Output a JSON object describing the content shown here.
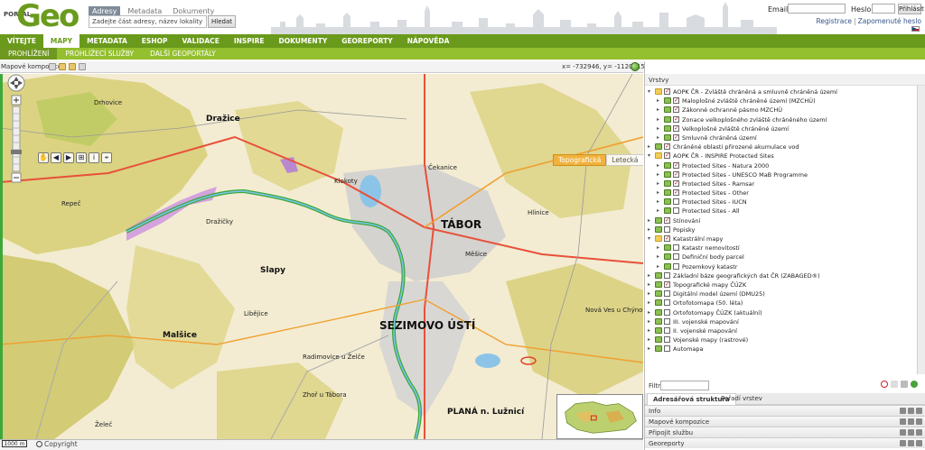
{
  "header": {
    "logo_small": "PORTAL",
    "logo_big": "Geo",
    "search_tabs": [
      "Adresy",
      "Metadata",
      "Dokumenty"
    ],
    "search_placeholder": "Zadejte část adresy, název lokality",
    "search_button": "Hledat",
    "login": {
      "email_label": "Email:",
      "password_label": "Heslo:",
      "login_button": "Přihlásit",
      "register_link": "Registrace",
      "separator": "|",
      "forgot_link": "Zapomenuté heslo"
    }
  },
  "main_nav": [
    "VÍTEJTE",
    "MAPY",
    "METADATA",
    "ESHOP",
    "VALIDACE",
    "INSPIRE",
    "DOKUMENTY",
    "GEOREPORTY",
    "NÁPOVĚDA"
  ],
  "sub_nav": [
    "PROHLÍŽENÍ",
    "PROHLÍŽECÍ SLUŽBY",
    "DALŠÍ GEOPORTÁLY"
  ],
  "map_toolbar": {
    "label": "Mapové kompozice",
    "coords": "x= -732946, y= -1120915"
  },
  "map": {
    "type_buttons": [
      "Topografická",
      "Letecká"
    ],
    "active_type": "Topografická",
    "labels": [
      "Drhovice",
      "Dražice",
      "Repeč",
      "Dražičky",
      "Slapy",
      "Libějice",
      "Malšice",
      "Radimovice u Želče",
      "Zhoř u Tábora",
      "Želeč",
      "TÁBOR",
      "SEZIMOVO ÚSTÍ",
      "PLANÁ n. Lužnicí",
      "Čekanice",
      "Klokoty",
      "Nová Ves u Chýnova",
      "Hlinice",
      "Měšice"
    ],
    "scale": "1000 m",
    "copyright": "Copyright"
  },
  "layers_panel": {
    "title": "Vrstvy",
    "tree": [
      {
        "level": 0,
        "type": "folder",
        "checked": true,
        "expanded": true,
        "label": "AOPK ČR - Zvláště chráněná a smluvně chráněná území"
      },
      {
        "level": 1,
        "type": "layer",
        "checked": true,
        "label": "Maloplošné zvláště chráněné území (MZCHÚ)"
      },
      {
        "level": 1,
        "type": "layer",
        "checked": true,
        "label": "Zákonné ochranné pásmo MZCHÚ"
      },
      {
        "level": 1,
        "type": "layer",
        "checked": true,
        "label": "Zonace velkoplošného zvláště chráněného území"
      },
      {
        "level": 1,
        "type": "layer",
        "checked": true,
        "label": "Velkoplošné zvláště chráněné území"
      },
      {
        "level": 1,
        "type": "layer",
        "checked": true,
        "label": "Smluvně chráněná území"
      },
      {
        "level": 0,
        "type": "layer",
        "checked": true,
        "label": "Chráněné oblasti přirozené akumulace vod"
      },
      {
        "level": 0,
        "type": "folder",
        "checked": true,
        "expanded": true,
        "label": "AOPK ČR - INSPIRE Protected Sites"
      },
      {
        "level": 1,
        "type": "layer",
        "checked": true,
        "label": "Protected Sites - Natura 2000"
      },
      {
        "level": 1,
        "type": "layer",
        "checked": true,
        "label": "Protected Sites - UNESCO MaB Programme"
      },
      {
        "level": 1,
        "type": "layer",
        "checked": true,
        "label": "Protected Sites - Ramsar"
      },
      {
        "level": 1,
        "type": "layer",
        "checked": true,
        "label": "Protected Sites - Other"
      },
      {
        "level": 1,
        "type": "layer",
        "checked": false,
        "label": "Protected Sites - IUCN"
      },
      {
        "level": 1,
        "type": "layer",
        "checked": false,
        "label": "Protected Sites - All"
      },
      {
        "level": 0,
        "type": "layer",
        "checked": true,
        "label": "Stínování"
      },
      {
        "level": 0,
        "type": "layer",
        "checked": false,
        "label": "Popisky"
      },
      {
        "level": 0,
        "type": "folder",
        "checked": true,
        "expanded": true,
        "label": "Katastrální mapy"
      },
      {
        "level": 1,
        "type": "layer",
        "checked": false,
        "label": "Katastr nemovitostí"
      },
      {
        "level": 1,
        "type": "layer",
        "checked": false,
        "label": "Definiční body parcel"
      },
      {
        "level": 1,
        "type": "layer",
        "checked": false,
        "label": "Pozemkový katastr"
      },
      {
        "level": 0,
        "type": "layer",
        "checked": false,
        "label": "Základní báze geografických dat ČR (ZABAGED®)"
      },
      {
        "level": 0,
        "type": "layer",
        "checked": true,
        "label": "Topografické mapy ČÚZK"
      },
      {
        "level": 0,
        "type": "layer",
        "checked": false,
        "label": "Digitální model území (DMU25)"
      },
      {
        "level": 0,
        "type": "layer",
        "checked": false,
        "label": "Ortofotomapa (50. léta)"
      },
      {
        "level": 0,
        "type": "layer",
        "checked": false,
        "label": "Ortofotomapy ČÚZK (aktuální)"
      },
      {
        "level": 0,
        "type": "layer",
        "checked": false,
        "label": "III. vojenské mapování"
      },
      {
        "level": 0,
        "type": "layer",
        "checked": false,
        "label": "II. vojenské mapování"
      },
      {
        "level": 0,
        "type": "layer",
        "checked": false,
        "label": "Vojenské mapy (rastrové)"
      },
      {
        "level": 0,
        "type": "layer",
        "checked": false,
        "label": "Automapa"
      }
    ],
    "filter_label": "Filtr:",
    "tabs": [
      "Adresářová struktura",
      "Pořadí vrstev"
    ],
    "accordion": [
      "Info",
      "Mapové kompozice",
      "Připojit službu",
      "Georeporty"
    ]
  },
  "colors": {
    "nav_green": "#6a9a1b",
    "subnav_green": "#94bf2e",
    "map_type_active": "#f0b23c"
  }
}
